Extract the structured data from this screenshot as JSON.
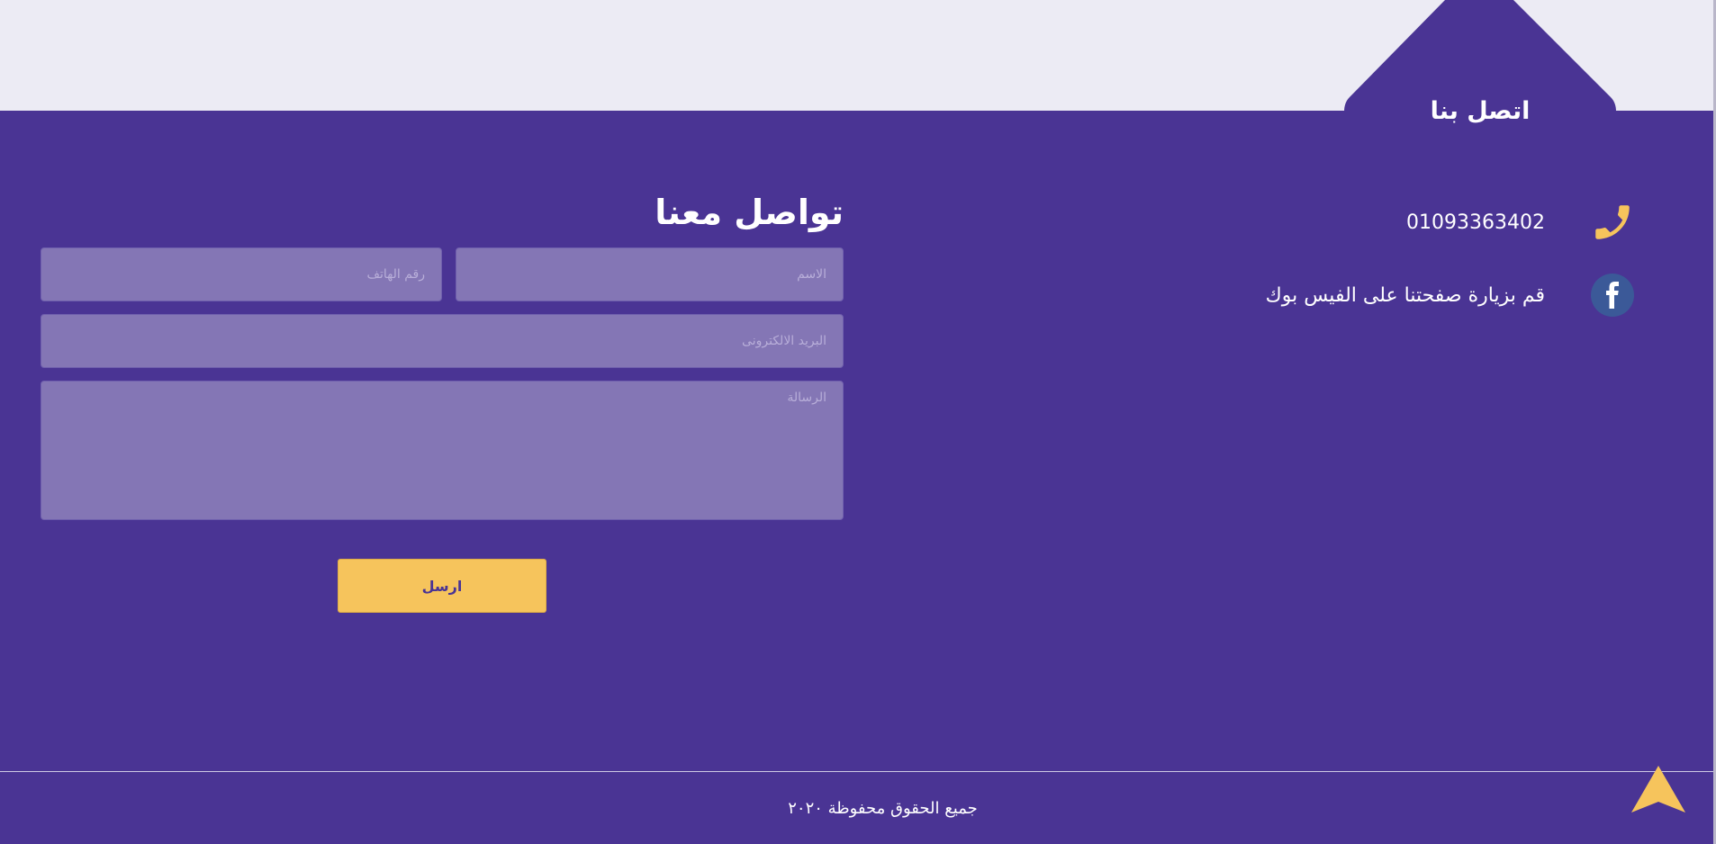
{
  "section": {
    "title": "اتصل بنا"
  },
  "contact": {
    "phone": "01093363402",
    "facebook_text": "قم بزيارة صفحتنا على الفيس بوك",
    "phone_icon": "phone-icon",
    "facebook_icon": "facebook-icon"
  },
  "form": {
    "title": "تواصل معنا",
    "name_placeholder": "الاسم",
    "phone_placeholder": "رقم الهاتف",
    "email_placeholder": "البريد الالكترونى",
    "message_placeholder": "الرسالة",
    "submit_label": "ارسل"
  },
  "footer": {
    "copyright": "جميع الحقوق محفوظة ٢٠٢٠"
  },
  "colors": {
    "primary": "#4a3494",
    "accent": "#f6c45c",
    "field": "#8476b5",
    "background": "#ecebf4",
    "facebook": "#3b5998"
  }
}
